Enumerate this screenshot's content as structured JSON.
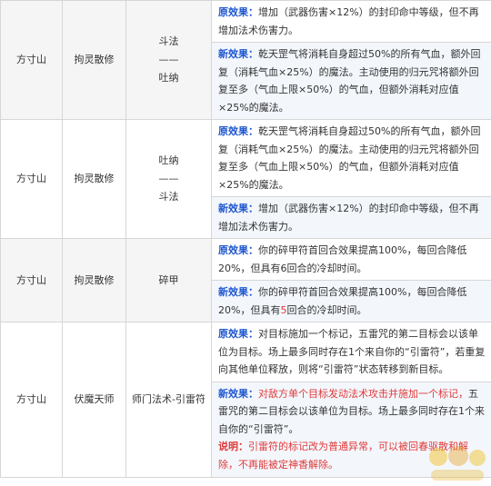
{
  "label_old": "原效果：",
  "label_new": "新效果：",
  "label_note": "说明：",
  "rows": [
    {
      "sect": "方寸山",
      "skill": "拘灵散修",
      "change_top": "斗法",
      "change_sep": "——",
      "change_bottom": "吐纳",
      "old": "增加（武器伤害×12%）的封印命中等级，但不再增加法术伤害力。",
      "new": "乾天罡气将消耗自身超过50%的所有气血，额外回复（消耗气血×25%）的魔法。主动使用的归元咒将额外回复至多（气血上限×50%）的气血，但额外消耗对应值×25%的魔法。"
    },
    {
      "sect": "方寸山",
      "skill": "拘灵散修",
      "change_top": "吐纳",
      "change_sep": "——",
      "change_bottom": "斗法",
      "old": "乾天罡气将消耗自身超过50%的所有气血，额外回复（消耗气血×25%）的魔法。主动使用的归元咒将额外回复至多（气血上限×50%）的气血，但额外消耗对应值×25%的魔法。",
      "new": "增加（武器伤害×12%）的封印命中等级，但不再增加法术伤害力。"
    },
    {
      "sect": "方寸山",
      "skill": "拘灵散修",
      "change": "碎甲",
      "old": "你的碎甲符首回合效果提高100%，每回合降低20%，但具有6回合的冷却时间。",
      "new_a": "你的碎甲符首回合效果提高100%，每回合降低20%，但具有",
      "new_red": "5",
      "new_b": "回合的冷却时间。"
    },
    {
      "sect": "方寸山",
      "skill": "伏魔天师",
      "change": "师门法术-引雷符",
      "old": "对目标施加一个标记，五雷咒的第二目标会以该单位为目标。场上最多同时存在1个来自你的“引雷符”，若重复向其他单位释放，则将“引雷符”状态转移到新目标。",
      "new_red": "对敌方单个目标发动法术攻击并施加一个标记，",
      "new_rest": "五雷咒的第二目标会以该单位为目标。场上最多同时存在1个来自你的“引雷符”。",
      "note": "引雷符的标记改为普通异常，可以被回春驱散和解除，不再能被定神香解除。"
    }
  ]
}
